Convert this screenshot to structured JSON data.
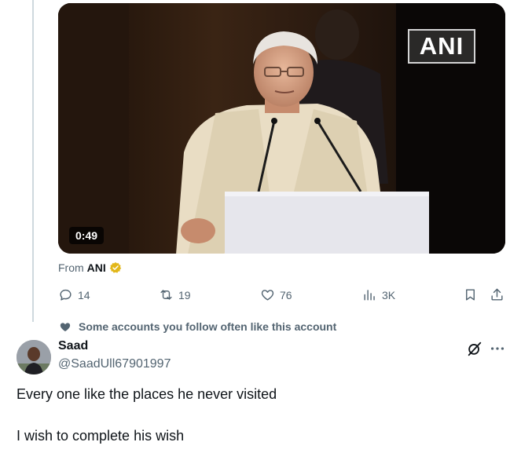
{
  "video": {
    "logo_text": "ANI",
    "duration": "0:49"
  },
  "source": {
    "prefix": "From",
    "name": "ANI"
  },
  "actions": {
    "replies": "14",
    "reposts": "19",
    "likes": "76",
    "views": "3K"
  },
  "social_context": "Some accounts you follow often like this account",
  "reply": {
    "name": "Saad",
    "handle": "@SaadUll67901997",
    "line1": "Every one like the places he never visited",
    "line2": "I wish to complete his wish"
  },
  "colors": {
    "text_primary": "#0f1419",
    "text_secondary": "#536471",
    "verified_gold": "#e2b719",
    "thread_line": "#cfd9de"
  },
  "icons": [
    "reply-icon",
    "repost-icon",
    "like-icon",
    "views-icon",
    "bookmark-icon",
    "share-icon",
    "heart-icon",
    "grok-icon",
    "more-icon",
    "verified-badge-icon"
  ]
}
